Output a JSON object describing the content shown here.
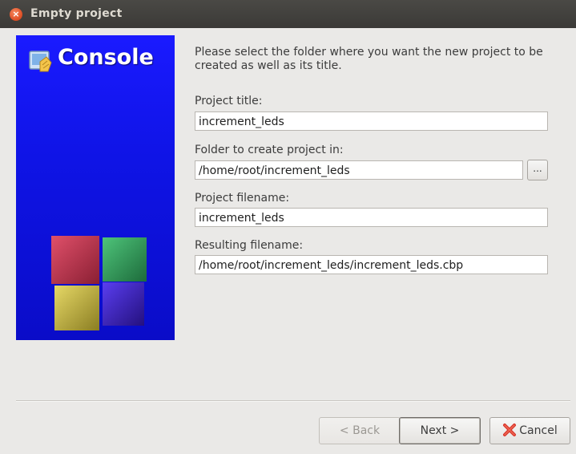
{
  "window": {
    "title": "Empty project",
    "close_glyph": "×"
  },
  "banner": {
    "title": "Console",
    "logo_icon": "codeblocks-logo-icon",
    "colors": {
      "background": "#1212f0",
      "cube_red": "#c0304a",
      "cube_green": "#2e9a55",
      "cube_yellow": "#b8aa3a",
      "cube_purple": "#3a1fb8"
    }
  },
  "main": {
    "intro": "Please select the folder where you want the new project to be created as well as its title.",
    "project_title": {
      "label": "Project title:",
      "value": "increment_leds"
    },
    "folder": {
      "label": "Folder to create project in:",
      "value": "/home/root/increment_leds",
      "browse_label": "..."
    },
    "project_filename": {
      "label": "Project filename:",
      "value": "increment_leds"
    },
    "resulting_filename": {
      "label": "Resulting filename:",
      "value": "/home/root/increment_leds/increment_leds.cbp"
    }
  },
  "buttons": {
    "back": "< Back",
    "next": "Next >",
    "cancel": "Cancel",
    "cancel_icon": "cancel-x-icon"
  }
}
